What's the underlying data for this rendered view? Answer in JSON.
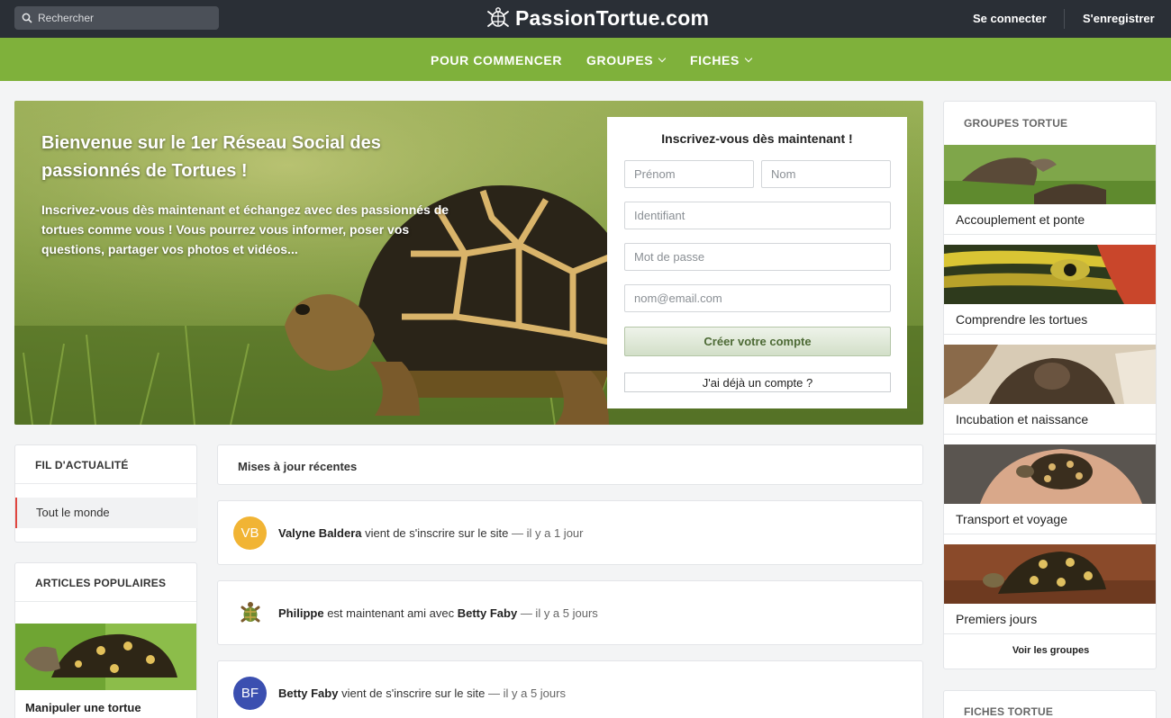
{
  "topbar": {
    "search_placeholder": "Rechercher",
    "logo_text": "PassionTortue.com",
    "login": "Se connecter",
    "register": "S'enregistrer"
  },
  "nav": {
    "items": [
      {
        "label": "POUR COMMENCER"
      },
      {
        "label": "GROUPES"
      },
      {
        "label": "FICHES"
      }
    ]
  },
  "hero": {
    "title": "Bienvenue sur le 1er Réseau Social des passionnés de Tortues !",
    "text": "Inscrivez-vous dès maintenant et échangez avec des passionnés de tortues comme vous ! Vous pourrez vous informer, poser vos questions, partager vos photos et vidéos..."
  },
  "signup": {
    "title": "Inscrivez-vous dès maintenant !",
    "firstname_placeholder": "Prénom",
    "lastname_placeholder": "Nom",
    "username_placeholder": "Identifiant",
    "password_placeholder": "Mot de passe",
    "email_placeholder": "nom@email.com",
    "create_button": "Créer votre compte",
    "have_account_button": "J'ai déjà un compte ?"
  },
  "feed": {
    "title": "FIL D'ACTUALITÉ",
    "items": [
      {
        "label": "Tout le monde"
      }
    ]
  },
  "popular": {
    "title": "ARTICLES POPULAIRES",
    "articles": [
      {
        "title": "Manipuler une tortue"
      }
    ]
  },
  "updates": {
    "title": "Mises à jour récentes",
    "items": [
      {
        "avatar": "VB",
        "user": "Valyne Baldera",
        "action": "vient de s'inscrire sur le site",
        "time": "— il y a 1 jour"
      },
      {
        "avatar": "turtle-icon",
        "user": "Philippe",
        "action": "est maintenant ami avec",
        "target": "Betty Faby",
        "time": "— il y a 5 jours"
      },
      {
        "avatar": "BF",
        "user": "Betty Faby",
        "action": "vient de s'inscrire sur le site",
        "time": "— il y a 5 jours"
      }
    ]
  },
  "groups": {
    "title": "GROUPES TORTUE",
    "items": [
      {
        "name": "Accouplement et ponte"
      },
      {
        "name": "Comprendre les tortues"
      },
      {
        "name": "Incubation et naissance"
      },
      {
        "name": "Transport et voyage"
      },
      {
        "name": "Premiers jours"
      }
    ],
    "see_all": "Voir les groupes"
  },
  "sheets": {
    "title": "FICHES TORTUE"
  },
  "colors": {
    "topbar": "#2a2f36",
    "nav_green": "#7fb13b",
    "accent_red": "#e0463f",
    "avatar_vb": "#f1b434",
    "avatar_bf": "#3b4fb0"
  }
}
